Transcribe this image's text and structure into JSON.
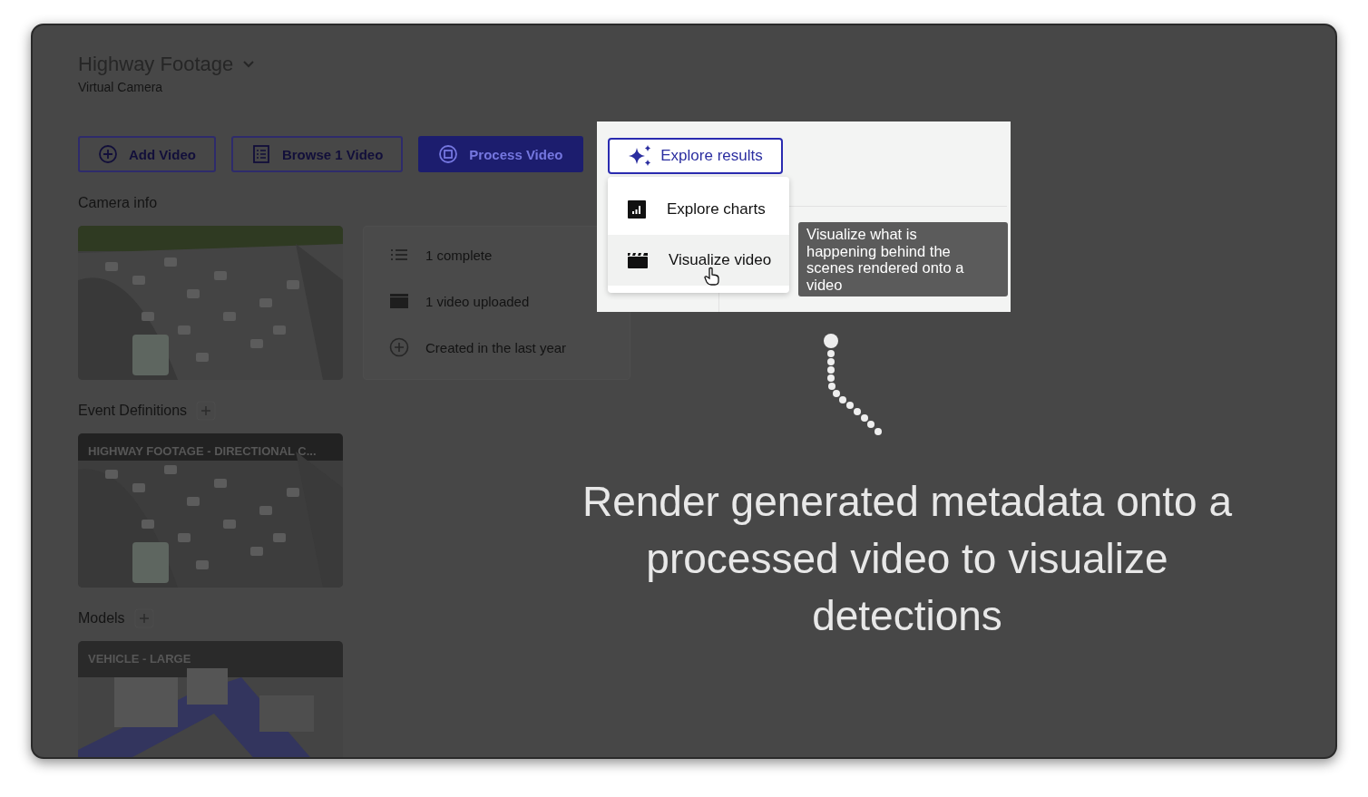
{
  "project": {
    "title": "Highway Footage",
    "subtitle": "Virtual Camera"
  },
  "actions": [
    {
      "label": "Add Video",
      "kind": "outline"
    },
    {
      "label": "Browse 1 Video",
      "kind": "outline"
    },
    {
      "label": "Process Video",
      "kind": "filled"
    }
  ],
  "camera_info": {
    "heading": "Camera info",
    "stats": [
      {
        "text": "1 complete"
      },
      {
        "text": "1 video uploaded"
      },
      {
        "text": "Created in the last year"
      }
    ]
  },
  "event_definitions": {
    "heading": "Event Definitions",
    "card": {
      "label": "HIGHWAY FOOTAGE - DIRECTIONAL C..."
    }
  },
  "models": {
    "heading": "Models",
    "card": {
      "label": "VEHICLE - LARGE"
    }
  },
  "highlight": {
    "button": "Explore results",
    "menu": [
      {
        "label": "Explore charts",
        "selected": false
      },
      {
        "label": "Visualize video",
        "selected": true
      }
    ],
    "tooltip": "Visualize what is happening behind the scenes rendered onto a video"
  },
  "caption": "Render generated metadata onto a processed video to visualize detections"
}
